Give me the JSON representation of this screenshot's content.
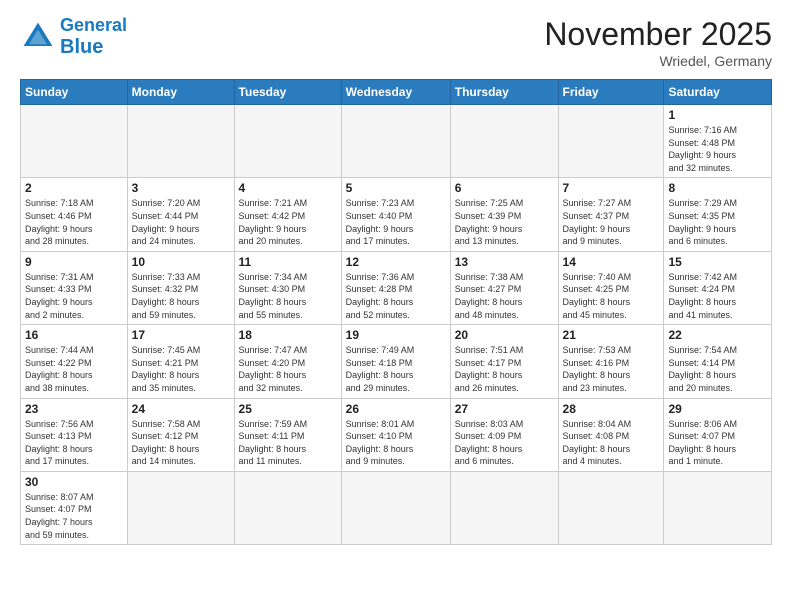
{
  "header": {
    "logo_line1": "General",
    "logo_line2": "Blue",
    "month_title": "November 2025",
    "location": "Wriedel, Germany"
  },
  "weekdays": [
    "Sunday",
    "Monday",
    "Tuesday",
    "Wednesday",
    "Thursday",
    "Friday",
    "Saturday"
  ],
  "weeks": [
    [
      {
        "day": "",
        "info": ""
      },
      {
        "day": "",
        "info": ""
      },
      {
        "day": "",
        "info": ""
      },
      {
        "day": "",
        "info": ""
      },
      {
        "day": "",
        "info": ""
      },
      {
        "day": "",
        "info": ""
      },
      {
        "day": "1",
        "info": "Sunrise: 7:16 AM\nSunset: 4:48 PM\nDaylight: 9 hours\nand 32 minutes."
      }
    ],
    [
      {
        "day": "2",
        "info": "Sunrise: 7:18 AM\nSunset: 4:46 PM\nDaylight: 9 hours\nand 28 minutes."
      },
      {
        "day": "3",
        "info": "Sunrise: 7:20 AM\nSunset: 4:44 PM\nDaylight: 9 hours\nand 24 minutes."
      },
      {
        "day": "4",
        "info": "Sunrise: 7:21 AM\nSunset: 4:42 PM\nDaylight: 9 hours\nand 20 minutes."
      },
      {
        "day": "5",
        "info": "Sunrise: 7:23 AM\nSunset: 4:40 PM\nDaylight: 9 hours\nand 17 minutes."
      },
      {
        "day": "6",
        "info": "Sunrise: 7:25 AM\nSunset: 4:39 PM\nDaylight: 9 hours\nand 13 minutes."
      },
      {
        "day": "7",
        "info": "Sunrise: 7:27 AM\nSunset: 4:37 PM\nDaylight: 9 hours\nand 9 minutes."
      },
      {
        "day": "8",
        "info": "Sunrise: 7:29 AM\nSunset: 4:35 PM\nDaylight: 9 hours\nand 6 minutes."
      }
    ],
    [
      {
        "day": "9",
        "info": "Sunrise: 7:31 AM\nSunset: 4:33 PM\nDaylight: 9 hours\nand 2 minutes."
      },
      {
        "day": "10",
        "info": "Sunrise: 7:33 AM\nSunset: 4:32 PM\nDaylight: 8 hours\nand 59 minutes."
      },
      {
        "day": "11",
        "info": "Sunrise: 7:34 AM\nSunset: 4:30 PM\nDaylight: 8 hours\nand 55 minutes."
      },
      {
        "day": "12",
        "info": "Sunrise: 7:36 AM\nSunset: 4:28 PM\nDaylight: 8 hours\nand 52 minutes."
      },
      {
        "day": "13",
        "info": "Sunrise: 7:38 AM\nSunset: 4:27 PM\nDaylight: 8 hours\nand 48 minutes."
      },
      {
        "day": "14",
        "info": "Sunrise: 7:40 AM\nSunset: 4:25 PM\nDaylight: 8 hours\nand 45 minutes."
      },
      {
        "day": "15",
        "info": "Sunrise: 7:42 AM\nSunset: 4:24 PM\nDaylight: 8 hours\nand 41 minutes."
      }
    ],
    [
      {
        "day": "16",
        "info": "Sunrise: 7:44 AM\nSunset: 4:22 PM\nDaylight: 8 hours\nand 38 minutes."
      },
      {
        "day": "17",
        "info": "Sunrise: 7:45 AM\nSunset: 4:21 PM\nDaylight: 8 hours\nand 35 minutes."
      },
      {
        "day": "18",
        "info": "Sunrise: 7:47 AM\nSunset: 4:20 PM\nDaylight: 8 hours\nand 32 minutes."
      },
      {
        "day": "19",
        "info": "Sunrise: 7:49 AM\nSunset: 4:18 PM\nDaylight: 8 hours\nand 29 minutes."
      },
      {
        "day": "20",
        "info": "Sunrise: 7:51 AM\nSunset: 4:17 PM\nDaylight: 8 hours\nand 26 minutes."
      },
      {
        "day": "21",
        "info": "Sunrise: 7:53 AM\nSunset: 4:16 PM\nDaylight: 8 hours\nand 23 minutes."
      },
      {
        "day": "22",
        "info": "Sunrise: 7:54 AM\nSunset: 4:14 PM\nDaylight: 8 hours\nand 20 minutes."
      }
    ],
    [
      {
        "day": "23",
        "info": "Sunrise: 7:56 AM\nSunset: 4:13 PM\nDaylight: 8 hours\nand 17 minutes."
      },
      {
        "day": "24",
        "info": "Sunrise: 7:58 AM\nSunset: 4:12 PM\nDaylight: 8 hours\nand 14 minutes."
      },
      {
        "day": "25",
        "info": "Sunrise: 7:59 AM\nSunset: 4:11 PM\nDaylight: 8 hours\nand 11 minutes."
      },
      {
        "day": "26",
        "info": "Sunrise: 8:01 AM\nSunset: 4:10 PM\nDaylight: 8 hours\nand 9 minutes."
      },
      {
        "day": "27",
        "info": "Sunrise: 8:03 AM\nSunset: 4:09 PM\nDaylight: 8 hours\nand 6 minutes."
      },
      {
        "day": "28",
        "info": "Sunrise: 8:04 AM\nSunset: 4:08 PM\nDaylight: 8 hours\nand 4 minutes."
      },
      {
        "day": "29",
        "info": "Sunrise: 8:06 AM\nSunset: 4:07 PM\nDaylight: 8 hours\nand 1 minute."
      }
    ],
    [
      {
        "day": "30",
        "info": "Sunrise: 8:07 AM\nSunset: 4:07 PM\nDaylight: 7 hours\nand 59 minutes."
      },
      {
        "day": "",
        "info": ""
      },
      {
        "day": "",
        "info": ""
      },
      {
        "day": "",
        "info": ""
      },
      {
        "day": "",
        "info": ""
      },
      {
        "day": "",
        "info": ""
      },
      {
        "day": "",
        "info": ""
      }
    ]
  ]
}
